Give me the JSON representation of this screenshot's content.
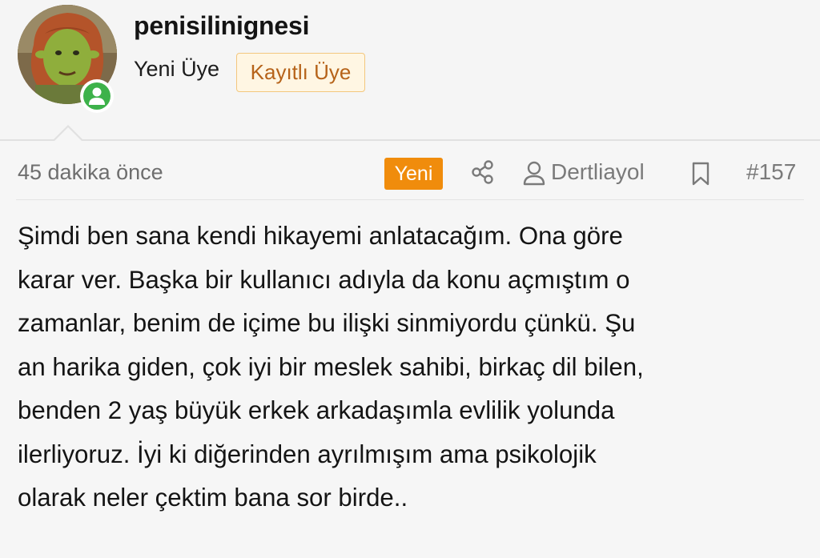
{
  "user": {
    "username": "penisilinignesi",
    "title": "Yeni Üye",
    "role_badge": "Kayıtlı Üye",
    "avatar_icon": "avatar-image",
    "online_icon": "user-online-icon",
    "online_color": "#3db24a"
  },
  "meta": {
    "timestamp": "45 dakika önce",
    "new_label": "Yeni",
    "new_color": "#f08c0c",
    "share_icon": "share-icon",
    "author_icon": "user-icon",
    "author": "Dertliayol",
    "bookmark_icon": "bookmark-icon",
    "post_number": "#157"
  },
  "message": {
    "text": "Şimdi ben sana kendi hikayemi anlatacağım. Ona göre\nkarar ver. Başka bir kullanıcı adıyla da konu açmıştım o\nzamanlar, benim de içime bu ilişki sinmiyordu çünkü. Şu\nan harika giden, çok iyi bir meslek sahibi, birkaç dil bilen,\nbenden 2 yaş büyük erkek arkadaşımla evlilik yolunda\nilerliyoruz. İyi ki diğerinden ayrılmışım ama psikolojik\nolarak neler çektim bana sor birde.."
  }
}
